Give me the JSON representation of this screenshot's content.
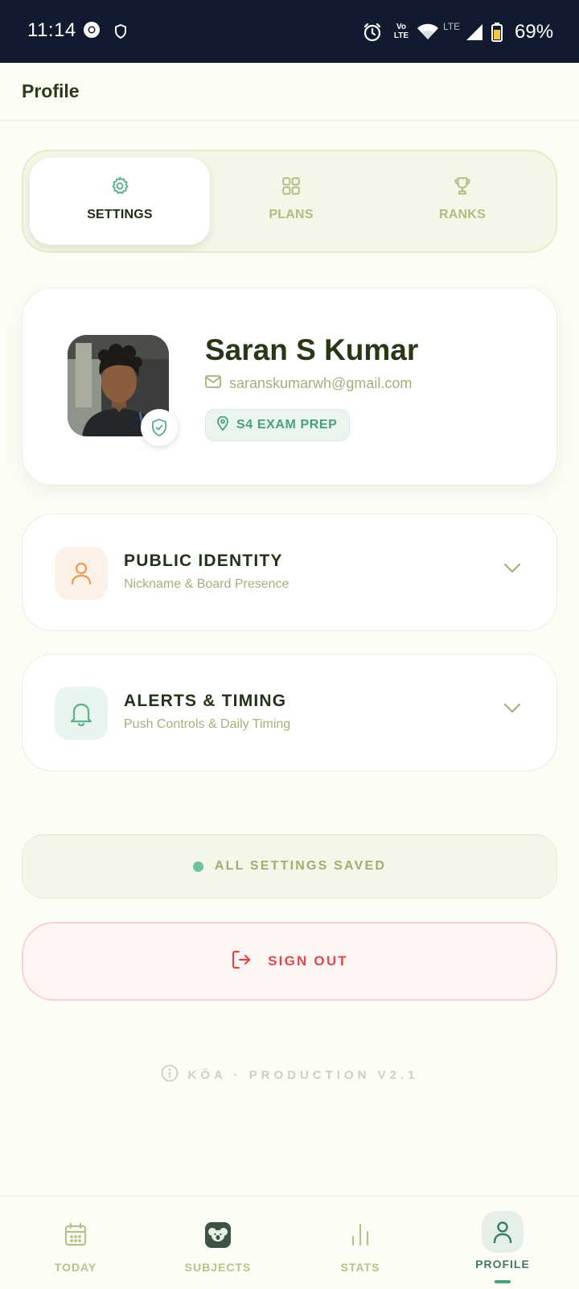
{
  "status_bar": {
    "time": "11:14",
    "battery": "69%",
    "network_small": "Vo LTE",
    "network_type": "LTE",
    "icons": [
      "chrome-icon",
      "vpn-shield-icon",
      "alarm-icon",
      "volte-icon",
      "wifi-icon",
      "signal-icon",
      "battery-icon"
    ]
  },
  "header": {
    "title": "Profile"
  },
  "segmented_tabs": [
    {
      "label": "SETTINGS",
      "icon": "gear-icon",
      "active": true
    },
    {
      "label": "PLANS",
      "icon": "grid-icon",
      "active": false
    },
    {
      "label": "RANKS",
      "icon": "trophy-icon",
      "active": false
    }
  ],
  "profile": {
    "name": "Saran S Kumar",
    "email": "saranskumarwh@gmail.com",
    "exam_tag": "S4 EXAM PREP",
    "verified_icon": "shield-check-icon"
  },
  "sections": [
    {
      "title": "PUBLIC IDENTITY",
      "subtitle": "Nickname & Board Presence",
      "icon": "user-icon",
      "accent": "#f29a52"
    },
    {
      "title": "ALERTS & TIMING",
      "subtitle": "Push Controls & Daily Timing",
      "icon": "bell-icon",
      "accent": "#5fae8e"
    }
  ],
  "save_status": "ALL SETTINGS SAVED",
  "sign_out": "SIGN OUT",
  "version_text": "KŌA · PRODUCTION V2.1",
  "bottom_nav": [
    {
      "label": "TODAY",
      "icon": "calendar-icon",
      "active": false
    },
    {
      "label": "SUBJECTS",
      "icon": "koala-icon",
      "active": false
    },
    {
      "label": "STATS",
      "icon": "bar-chart-icon",
      "active": false
    },
    {
      "label": "PROFILE",
      "icon": "person-icon",
      "active": true
    }
  ],
  "colors": {
    "accent_green": "#4aa07c",
    "danger_red": "#e0474d",
    "muted_olive": "#a7ae7c",
    "dark_text": "#2a3717",
    "background": "#fdfdf6"
  }
}
